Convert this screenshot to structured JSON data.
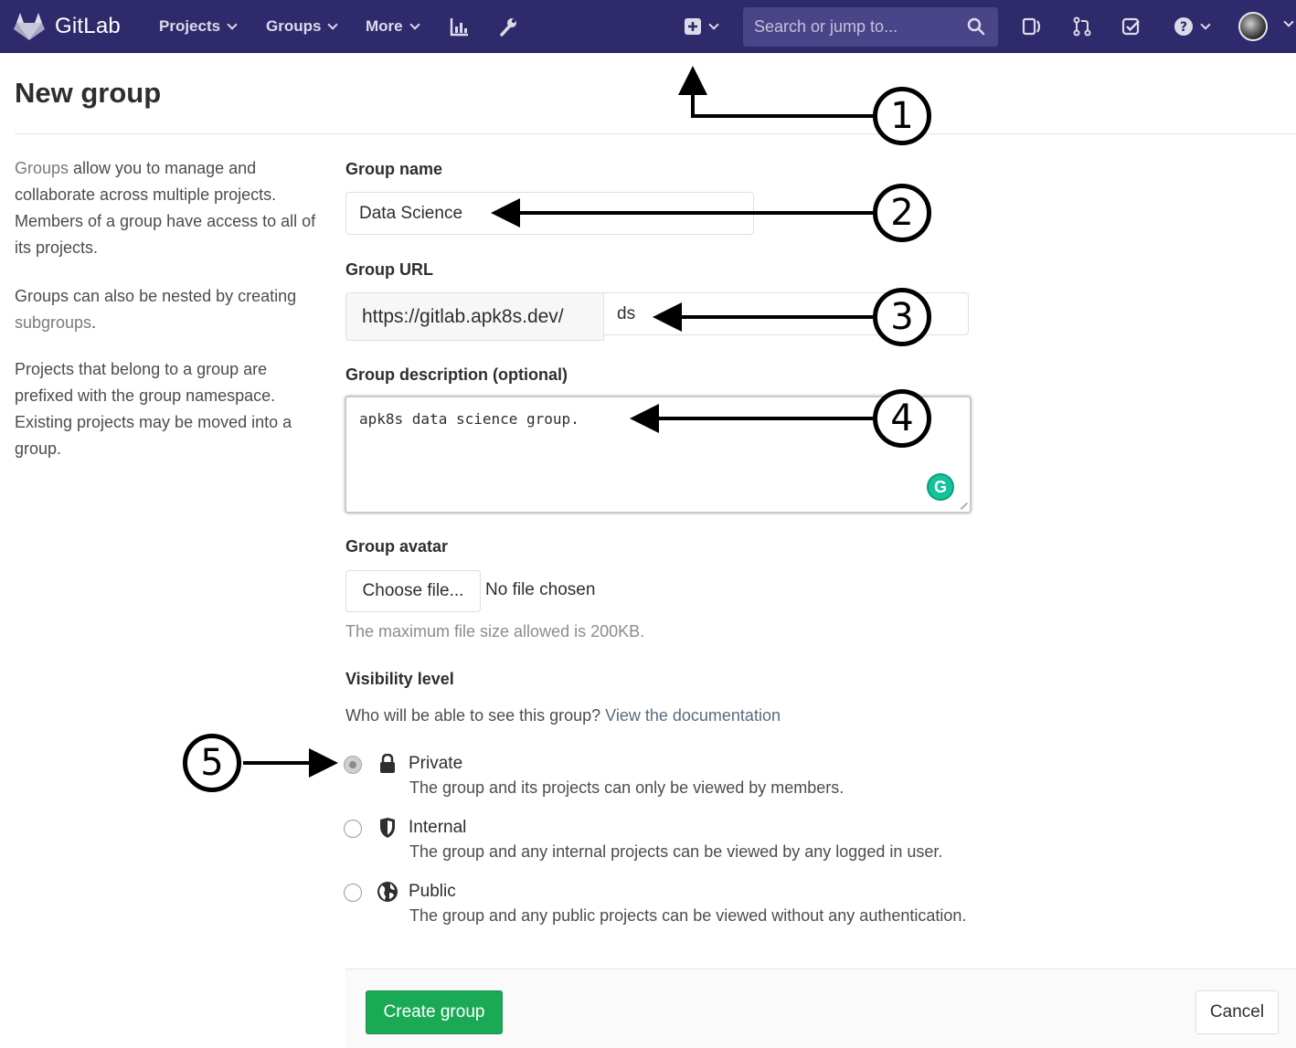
{
  "navbar": {
    "brand": "GitLab",
    "links": [
      "Projects",
      "Groups",
      "More"
    ],
    "search_placeholder": "Search or jump to..."
  },
  "page": {
    "title": "New group",
    "sidebar": {
      "p1_link": "Groups",
      "p1_text": " allow you to manage and collaborate across multiple projects. Members of a group have access to all of its projects.",
      "p2_text": "Groups can also be nested by creating ",
      "p2_link": "subgroups",
      "p2_end": ".",
      "p3_text": "Projects that belong to a group are prefixed with the group namespace. Existing projects may be moved into a group."
    }
  },
  "form": {
    "group_name_label": "Group name",
    "group_name_value": "Data Science",
    "group_url_label": "Group URL",
    "group_url_prefix": "https://gitlab.apk8s.dev/",
    "group_url_value": "ds",
    "description_label": "Group description (optional)",
    "description_value": "apk8s data science group.",
    "avatar_label": "Group avatar",
    "choose_file": "Choose file...",
    "no_file": "No file chosen",
    "avatar_help": "The maximum file size allowed is 200KB.",
    "visibility_label": "Visibility level",
    "visibility_question": "Who will be able to see this group? ",
    "visibility_doc_link": "View the documentation",
    "visibility_options": [
      {
        "title": "Private",
        "desc": "The group and its projects can only be viewed by members.",
        "selected": true
      },
      {
        "title": "Internal",
        "desc": "The group and any internal projects can be viewed by any logged in user.",
        "selected": false
      },
      {
        "title": "Public",
        "desc": "The group and any public projects can be viewed without any authentication.",
        "selected": false
      }
    ],
    "create_button": "Create group",
    "cancel_button": "Cancel"
  },
  "callouts": [
    "1",
    "2",
    "3",
    "4",
    "5"
  ],
  "colors": {
    "navbar": "#2f2a6b",
    "search": "#4a4589",
    "primary_button": "#1aaa55",
    "grammarly": "#15c39a"
  },
  "icons": [
    "gitlab-logo-icon",
    "activity-chart-icon",
    "wrench-icon",
    "plus-square-icon",
    "search-icon",
    "sidebar-toggle-icon",
    "merge-request-icon",
    "todo-check-icon",
    "help-icon",
    "lock-icon",
    "shield-icon",
    "globe-icon",
    "grammarly-icon"
  ]
}
